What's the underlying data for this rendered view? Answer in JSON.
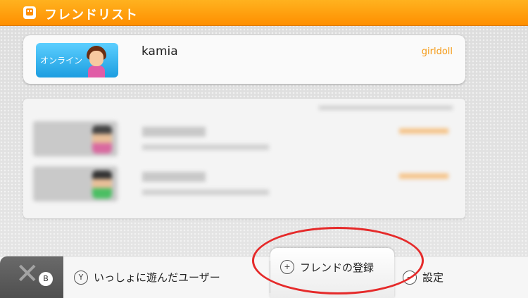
{
  "header": {
    "title": "フレンドリスト",
    "icon": "smiley-app-icon"
  },
  "own_card": {
    "status": "オンライン",
    "name": "kamia",
    "id": "girldoll"
  },
  "friends": [
    {
      "avatar_color": "#d96aa0"
    },
    {
      "avatar_color": "#4bbf63"
    }
  ],
  "bottom_bar": {
    "close_badge": "B",
    "played_key": "Y",
    "played_label": "いっしょに遊んだユーザー",
    "register_key": "+",
    "register_label": "フレンドの登録",
    "settings_key": "−",
    "settings_label": "設定"
  },
  "colors": {
    "header": "#ff9c0a",
    "accent_id": "#f59a16",
    "online": "#1c9de0",
    "highlight_ring": "#e52a2a"
  }
}
